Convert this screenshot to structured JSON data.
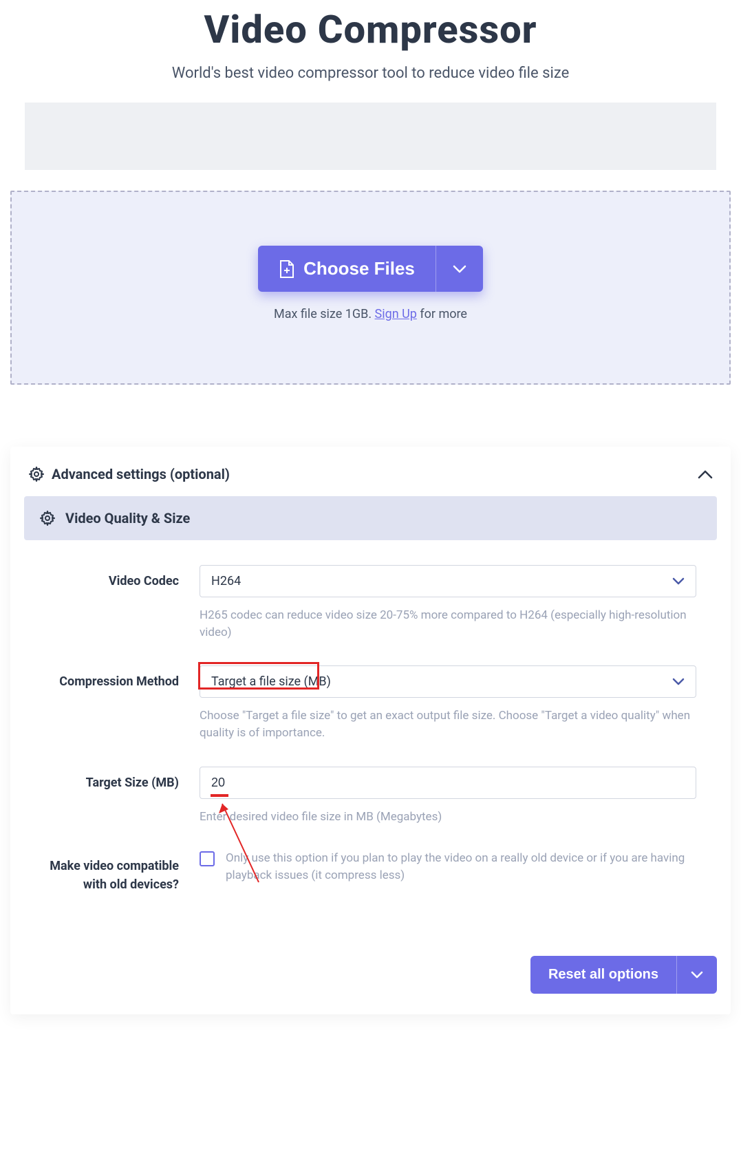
{
  "header": {
    "title": "Video Compressor",
    "subtitle": "World's best video compressor tool to reduce video file size"
  },
  "dropzone": {
    "choose_label": "Choose Files",
    "hint_prefix": "Max file size 1GB. ",
    "signup_label": "Sign Up",
    "hint_suffix": " for more"
  },
  "panel": {
    "advanced_label": "Advanced settings (optional)",
    "section_label": "Video Quality & Size"
  },
  "form": {
    "codec": {
      "label": "Video Codec",
      "value": "H264",
      "hint": "H265 codec can reduce video size 20-75% more compared to H264 (especially high-resolution video)"
    },
    "method": {
      "label": "Compression Method",
      "value": "Target a file size (MB)",
      "hint": "Choose \"Target a file size\" to get an exact output file size. Choose \"Target a video quality\" when quality is of importance."
    },
    "target": {
      "label": "Target Size (MB)",
      "value": "20",
      "hint": "Enter desired video file size in MB (Megabytes)"
    },
    "compat": {
      "label": "Make video compatible with old devices?",
      "hint": "Only use this option if you plan to play the video on a really old device or if you are having playback issues (it compress less)"
    }
  },
  "footer": {
    "reset_label": "Reset all options"
  }
}
